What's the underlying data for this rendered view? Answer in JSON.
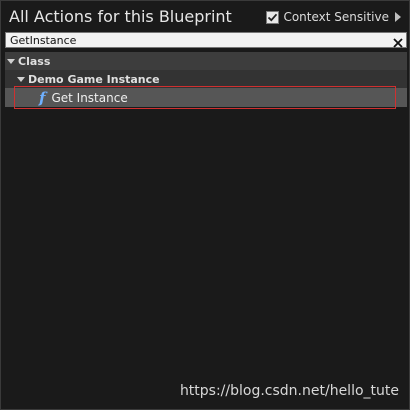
{
  "header": {
    "title": "All Actions for this Blueprint",
    "context_sensitive_label": "Context Sensitive",
    "context_sensitive_checked": true
  },
  "search": {
    "value": "GetInstance"
  },
  "tree": {
    "category": "Class",
    "subcategory": "Demo Game Instance",
    "item": {
      "icon": "function-icon",
      "label": "Get Instance"
    }
  },
  "watermark": "https://blog.csdn.net/hello_tute",
  "colors": {
    "background": "#1a1a1a",
    "selected_row": "#565656",
    "function_icon": "#6fb0ff",
    "highlight_border": "#d03030"
  }
}
